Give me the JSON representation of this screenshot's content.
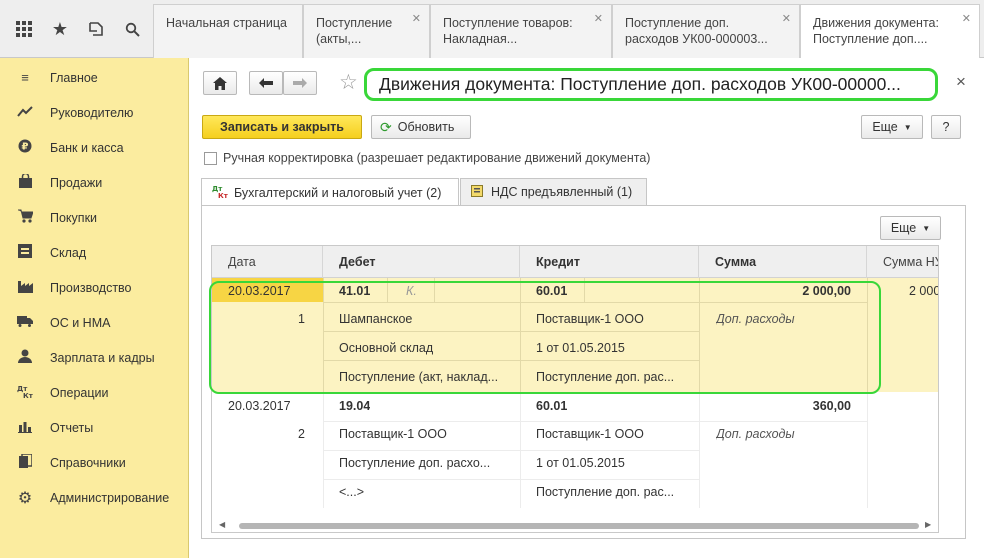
{
  "toolbar_icons": [
    "grid-icon",
    "star-icon",
    "history-icon",
    "search-icon"
  ],
  "tabs": [
    {
      "line1": "Начальная страница",
      "line2": ""
    },
    {
      "line1": "Поступление",
      "line2": "(акты,..."
    },
    {
      "line1": "Поступление товаров:",
      "line2": "Накладная..."
    },
    {
      "line1": "Поступление доп.",
      "line2": "расходов УК00-000003..."
    },
    {
      "line1": "Движения документа:",
      "line2": "Поступление доп...."
    }
  ],
  "sidebar": {
    "items": [
      {
        "label": "Главное",
        "icon": "menu-icon"
      },
      {
        "label": "Руководителю",
        "icon": "trend-icon"
      },
      {
        "label": "Банк и касса",
        "icon": "ruble-icon"
      },
      {
        "label": "Продажи",
        "icon": "bag-icon"
      },
      {
        "label": "Покупки",
        "icon": "cart-icon"
      },
      {
        "label": "Склад",
        "icon": "warehouse-icon"
      },
      {
        "label": "Производство",
        "icon": "factory-icon"
      },
      {
        "label": "ОС и НМА",
        "icon": "truck-icon"
      },
      {
        "label": "Зарплата и кадры",
        "icon": "person-icon"
      },
      {
        "label": "Операции",
        "icon": "dtkt-icon"
      },
      {
        "label": "Отчеты",
        "icon": "bar-chart-icon"
      },
      {
        "label": "Справочники",
        "icon": "book-icon"
      },
      {
        "label": "Администрирование",
        "icon": "gear-icon"
      }
    ]
  },
  "window": {
    "title": "Движения документа: Поступление доп. расходов УК00-00000...",
    "save_close": "Записать и закрыть",
    "refresh": "Обновить",
    "more": "Еще",
    "help": "?",
    "close": "×",
    "manual_correction": "Ручная корректировка (разрешает редактирование движений документа)"
  },
  "inner_tabs": [
    {
      "label": "Бухгалтерский и налоговый учет (2)"
    },
    {
      "label": "НДС предъявленный (1)"
    }
  ],
  "grid": {
    "more": "Еще",
    "columns": [
      "Дата",
      "Дебет",
      "Кредит",
      "Сумма",
      "Сумма НУ"
    ],
    "rows": [
      {
        "date": "20.03.2017",
        "num": "1",
        "debit": [
          "41.01",
          "Шампанское",
          "Основной склад",
          "Поступление (акт, наклад..."
        ],
        "debit_k": "К.",
        "credit": [
          "60.01",
          "Поставщик-1 ООО",
          "1 от 01.05.2015",
          "Поступление доп. рас..."
        ],
        "amount": "2 000,00",
        "amount_note": "Доп. расходы",
        "amount_nu": "2 000"
      },
      {
        "date": "20.03.2017",
        "num": "2",
        "debit": [
          "19.04",
          "Поставщик-1 ООО",
          "Поступление доп. расхо...",
          "<...>"
        ],
        "debit_k": "",
        "credit": [
          "60.01",
          "Поставщик-1 ООО",
          "1 от 01.05.2015",
          "Поступление доп. рас..."
        ],
        "amount": "360,00",
        "amount_note": "Доп. расходы",
        "amount_nu": ""
      }
    ]
  },
  "colors": {
    "sidebar_bg": "#fbec9f",
    "highlight": "#39d739",
    "primary_button": "#f5cf1e",
    "selected_row": "#fcf3c2"
  }
}
